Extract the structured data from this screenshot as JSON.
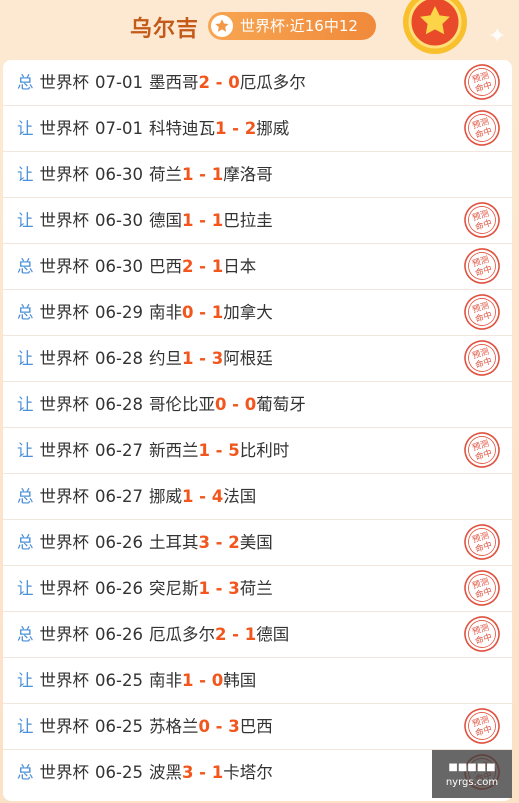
{
  "header": {
    "title": "乌尔吉",
    "badge": "世界杯·近16中12"
  },
  "matches": [
    {
      "type": "总",
      "league": "世界杯",
      "date": "07-01",
      "home": "墨西哥",
      "hs": "2",
      "sep": " - ",
      "as": "0",
      "away": "厄瓜多尔",
      "hit": true,
      "stamp": "预测命中"
    },
    {
      "type": "让",
      "league": "世界杯",
      "date": "07-01",
      "home": "科特迪瓦",
      "hs": "1",
      "sep": " - ",
      "as": "2",
      "away": "挪威",
      "hit": true,
      "stamp": "预测命中"
    },
    {
      "type": "让",
      "league": "世界杯",
      "date": "06-30",
      "home": "荷兰",
      "hs": "1",
      "sep": " - ",
      "as": "1",
      "away": "摩洛哥",
      "hit": false
    },
    {
      "type": "让",
      "league": "世界杯",
      "date": "06-30",
      "home": "德国",
      "hs": "1",
      "sep": " - ",
      "as": "1",
      "away": "巴拉圭",
      "hit": true,
      "stamp": "预测命中"
    },
    {
      "type": "总",
      "league": "世界杯",
      "date": "06-30",
      "home": "巴西",
      "hs": "2",
      "sep": " - ",
      "as": "1",
      "away": "日本",
      "hit": true,
      "stamp": "预测命中"
    },
    {
      "type": "总",
      "league": "世界杯",
      "date": "06-29",
      "home": "南非",
      "hs": "0",
      "sep": " - ",
      "as": "1",
      "away": "加拿大",
      "hit": true,
      "stamp": "预测命中"
    },
    {
      "type": "让",
      "league": "世界杯",
      "date": "06-28",
      "home": "约旦",
      "hs": "1",
      "sep": " - ",
      "as": "3",
      "away": "阿根廷",
      "hit": true,
      "stamp": "预测命中"
    },
    {
      "type": "让",
      "league": "世界杯",
      "date": "06-28",
      "home": "哥伦比亚",
      "hs": "0",
      "sep": " - ",
      "as": "0",
      "away": "葡萄牙",
      "hit": false
    },
    {
      "type": "让",
      "league": "世界杯",
      "date": "06-27",
      "home": "新西兰",
      "hs": "1",
      "sep": " - ",
      "as": "5",
      "away": "比利时",
      "hit": true,
      "stamp": "预测命中"
    },
    {
      "type": "总",
      "league": "世界杯",
      "date": "06-27",
      "home": "挪威",
      "hs": "1",
      "sep": " - ",
      "as": "4",
      "away": "法国",
      "hit": false
    },
    {
      "type": "总",
      "league": "世界杯",
      "date": "06-26",
      "home": "土耳其",
      "hs": "3",
      "sep": " - ",
      "as": "2",
      "away": "美国",
      "hit": true,
      "stamp": "预测命中"
    },
    {
      "type": "让",
      "league": "世界杯",
      "date": "06-26",
      "home": "突尼斯",
      "hs": "1",
      "sep": " - ",
      "as": "3",
      "away": "荷兰",
      "hit": true,
      "stamp": "预测命中"
    },
    {
      "type": "总",
      "league": "世界杯",
      "date": "06-26",
      "home": "厄瓜多尔",
      "hs": "2",
      "sep": " - ",
      "as": "1",
      "away": "德国",
      "hit": true,
      "stamp": "预测命中"
    },
    {
      "type": "让",
      "league": "世界杯",
      "date": "06-25",
      "home": "南非",
      "hs": "1",
      "sep": " - ",
      "as": "0",
      "away": "韩国",
      "hit": false
    },
    {
      "type": "让",
      "league": "世界杯",
      "date": "06-25",
      "home": "苏格兰",
      "hs": "0",
      "sep": " - ",
      "as": "3",
      "away": "巴西",
      "hit": true,
      "stamp": "预测命中"
    },
    {
      "type": "总",
      "league": "世界杯",
      "date": "06-25",
      "home": "波黑",
      "hs": "3",
      "sep": " - ",
      "as": "1",
      "away": "卡塔尔",
      "hit": true,
      "stamp": "预测命中"
    }
  ],
  "watermark": {
    "line1": "■■■■■",
    "line2": "nyrgs.com"
  },
  "colors": {
    "accent": "#f2561d",
    "type": "#4a8fd8",
    "stamp": "#e0523f",
    "badge": "#f29848"
  }
}
